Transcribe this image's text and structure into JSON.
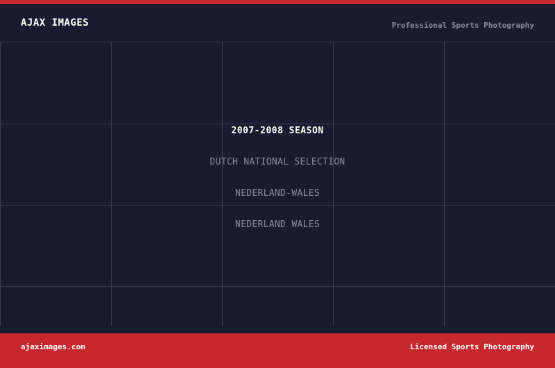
{
  "header": {
    "brand": "AJAX IMAGES",
    "tagline": "Professional Sports Photography"
  },
  "content": {
    "season": "2007-2008 SEASON",
    "lines": [
      "DUTCH NATIONAL SELECTION",
      "NEDERLAND-WALES",
      "NEDERLAND WALES"
    ]
  },
  "footer": {
    "website": "ajaximages.com",
    "license": "Licensed Sports Photography"
  },
  "colors": {
    "background": "#1a1b2e",
    "accent": "#c6282e",
    "grid": "#3a3c52",
    "muted_text": "#8b8d9e"
  }
}
